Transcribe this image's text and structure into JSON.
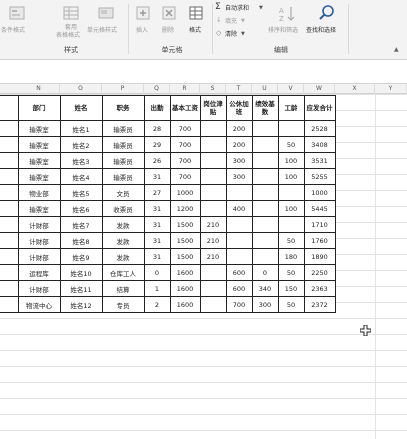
{
  "ribbon": {
    "styles": {
      "conditional_format": "条件格式",
      "table_format": "套用",
      "table_format_2": "表格格式",
      "cell_style": "单元格样式",
      "group_label": "样式"
    },
    "cells": {
      "insert": "插入",
      "delete": "删除",
      "format": "格式",
      "group_label": "单元格"
    },
    "editing": {
      "autosum": "自动求和",
      "fill": "填充",
      "clear": "清除",
      "sort_filter": "排序和筛选",
      "find_select": "查找和选择",
      "group_label": "编辑"
    }
  },
  "columns": [
    "N",
    "O",
    "P",
    "Q",
    "R",
    "S",
    "T",
    "U",
    "V",
    "W",
    "X",
    "Y"
  ],
  "table": {
    "headers": [
      "部门",
      "姓名",
      "职务",
      "出勤",
      "基本工资",
      "岗位津贴",
      "公休加班",
      "绩效基数",
      "工龄",
      "应发合计"
    ],
    "rows": [
      [
        "输票室",
        "姓名1",
        "输票员",
        "28",
        "700",
        "",
        "200",
        "",
        "",
        "2528"
      ],
      [
        "输票室",
        "姓名2",
        "输票员",
        "29",
        "700",
        "",
        "200",
        "",
        "50",
        "3408"
      ],
      [
        "输票室",
        "姓名3",
        "输票员",
        "26",
        "700",
        "",
        "300",
        "",
        "100",
        "3531"
      ],
      [
        "输票室",
        "姓名4",
        "输票员",
        "31",
        "700",
        "",
        "300",
        "",
        "100",
        "5255"
      ],
      [
        "物业部",
        "姓名5",
        "文员",
        "27",
        "1000",
        "",
        "",
        "",
        "",
        "1000"
      ],
      [
        "输票室",
        "姓名6",
        "收票员",
        "31",
        "1200",
        "",
        "400",
        "",
        "100",
        "5445"
      ],
      [
        "计财部",
        "姓名7",
        "发款",
        "31",
        "1500",
        "210",
        "",
        "",
        "",
        "1710"
      ],
      [
        "计财部",
        "姓名8",
        "发款",
        "31",
        "1500",
        "210",
        "",
        "",
        "50",
        "1760"
      ],
      [
        "计财部",
        "姓名9",
        "发款",
        "31",
        "1500",
        "210",
        "",
        "",
        "180",
        "1890"
      ],
      [
        "运程库",
        "姓名10",
        "仓库工人",
        "0",
        "1600",
        "",
        "600",
        "0",
        "50",
        "2250"
      ],
      [
        "计财部",
        "姓名11",
        "结算",
        "1",
        "1600",
        "",
        "600",
        "340",
        "150",
        "2363"
      ],
      [
        "物流中心",
        "姓名12",
        "专员",
        "2",
        "1600",
        "",
        "700",
        "300",
        "50",
        "2372"
      ]
    ]
  }
}
